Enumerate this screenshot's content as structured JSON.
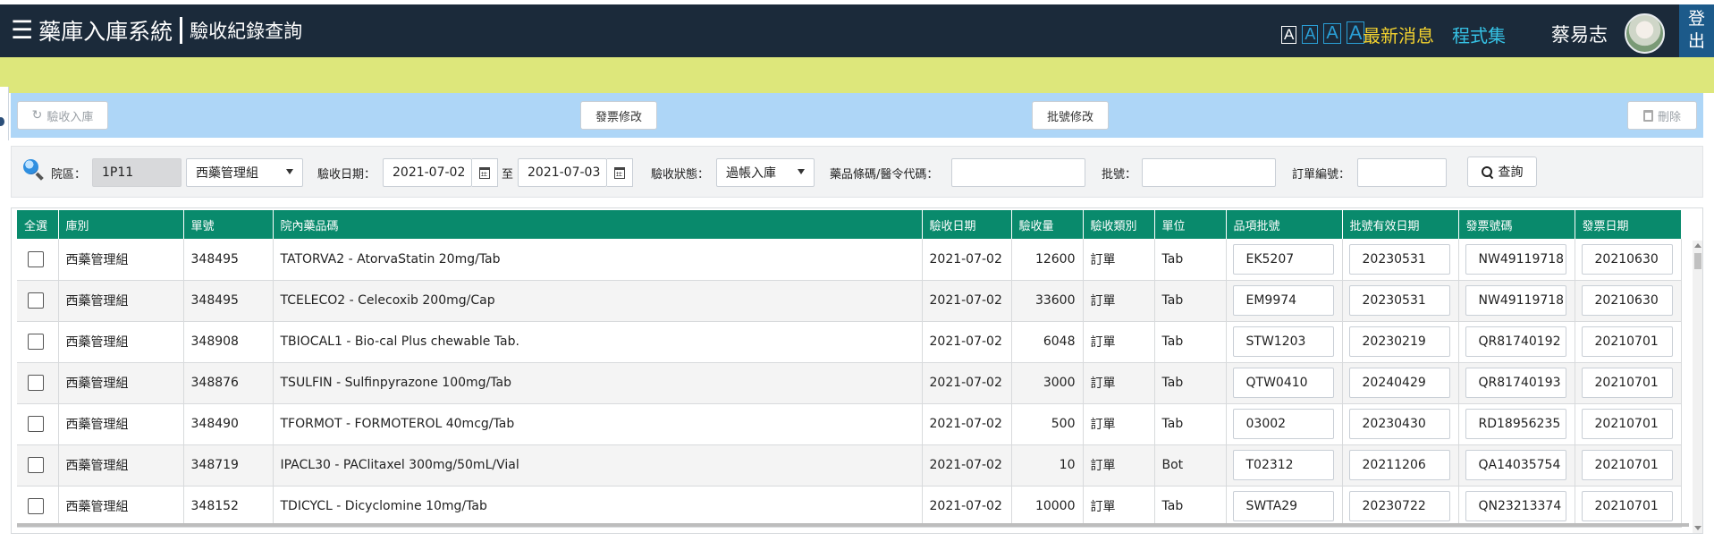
{
  "header": {
    "system_title": "藥庫入庫系統",
    "page_title": "驗收紀錄查詢",
    "font_sizes": [
      "A",
      "A",
      "A",
      "A"
    ],
    "news_label": "最新消息",
    "programs_label": "程式集",
    "user_name": "蔡易志",
    "logout_label": "登出",
    "logout_line1": "登",
    "logout_line2": "出"
  },
  "actions": {
    "receive_label": "驗收入庫",
    "invoice_edit_label": "發票修改",
    "batch_edit_label": "批號修改",
    "delete_label": "刪除"
  },
  "filters": {
    "hospital_label": "院區：",
    "hospital_value": "1P11",
    "group_value": "西藥管理組",
    "date_label": "驗收日期：",
    "date_from": "2021-07-02",
    "date_to_label": "至",
    "date_to": "2021-07-03",
    "status_label": "驗收狀態：",
    "status_value": "過帳入庫",
    "barcode_label": "藥品條碼/醫令代碼：",
    "barcode_value": "",
    "batch_label": "批號：",
    "batch_value": "",
    "order_label": "訂單編號：",
    "order_value": "",
    "query_label": "查詢"
  },
  "table": {
    "columns": [
      "全選",
      "庫別",
      "單號",
      "院內藥品碼",
      "驗收日期",
      "驗收量",
      "驗收類別",
      "單位",
      "品項批號",
      "批號有效日期",
      "發票號碼",
      "發票日期"
    ],
    "rows": [
      {
        "warehouse": "西藥管理組",
        "order_no": "348495",
        "drug": "TATORVA2 - AtorvaStatin 20mg/Tab",
        "date": "2021-07-02",
        "qty": "12600",
        "type": "訂單",
        "unit": "Tab",
        "batch": "EK5207",
        "expiry": "20230531",
        "invoice_no": "NW49119718",
        "invoice_date": "20210630"
      },
      {
        "warehouse": "西藥管理組",
        "order_no": "348495",
        "drug": "TCELECO2 - Celecoxib 200mg/Cap",
        "date": "2021-07-02",
        "qty": "33600",
        "type": "訂單",
        "unit": "Tab",
        "batch": "EM9974",
        "expiry": "20230531",
        "invoice_no": "NW49119718",
        "invoice_date": "20210630"
      },
      {
        "warehouse": "西藥管理組",
        "order_no": "348908",
        "drug": "TBIOCAL1 - Bio-cal Plus chewable Tab.",
        "date": "2021-07-02",
        "qty": "6048",
        "type": "訂單",
        "unit": "Tab",
        "batch": "STW1203",
        "expiry": "20230219",
        "invoice_no": "QR81740192",
        "invoice_date": "20210701"
      },
      {
        "warehouse": "西藥管理組",
        "order_no": "348876",
        "drug": "TSULFIN  - Sulfinpyrazone 100mg/Tab",
        "date": "2021-07-02",
        "qty": "3000",
        "type": "訂單",
        "unit": "Tab",
        "batch": "QTW0410",
        "expiry": "20240429",
        "invoice_no": "QR81740193",
        "invoice_date": "20210701"
      },
      {
        "warehouse": "西藥管理組",
        "order_no": "348490",
        "drug": "TFORMOT  - FORMOTEROL 40mcg/Tab",
        "date": "2021-07-02",
        "qty": "500",
        "type": "訂單",
        "unit": "Tab",
        "batch": "03002",
        "expiry": "20230430",
        "invoice_no": "RD18956235",
        "invoice_date": "20210701"
      },
      {
        "warehouse": "西藥管理組",
        "order_no": "348719",
        "drug": "IPACL30  - PAClitaxel 300mg/50mL/Vial",
        "date": "2021-07-02",
        "qty": "10",
        "type": "訂單",
        "unit": "Bot",
        "batch": "T02312",
        "expiry": "20211206",
        "invoice_no": "QA14035754",
        "invoice_date": "20210701"
      },
      {
        "warehouse": "西藥管理組",
        "order_no": "348152",
        "drug": "TDICYCL  - Dicyclomine 10mg/Tab",
        "date": "2021-07-02",
        "qty": "10000",
        "type": "訂單",
        "unit": "Tab",
        "batch": "SWTA29",
        "expiry": "20230722",
        "invoice_no": "QN23213374",
        "invoice_date": "20210701"
      }
    ]
  },
  "colors": {
    "header_bg": "#1b2a3a",
    "yellow_band": "#dde77b",
    "action_bar": "#aed6f7",
    "table_header": "#098a6c",
    "news": "#f2d12f",
    "programs": "#36c3e6"
  }
}
